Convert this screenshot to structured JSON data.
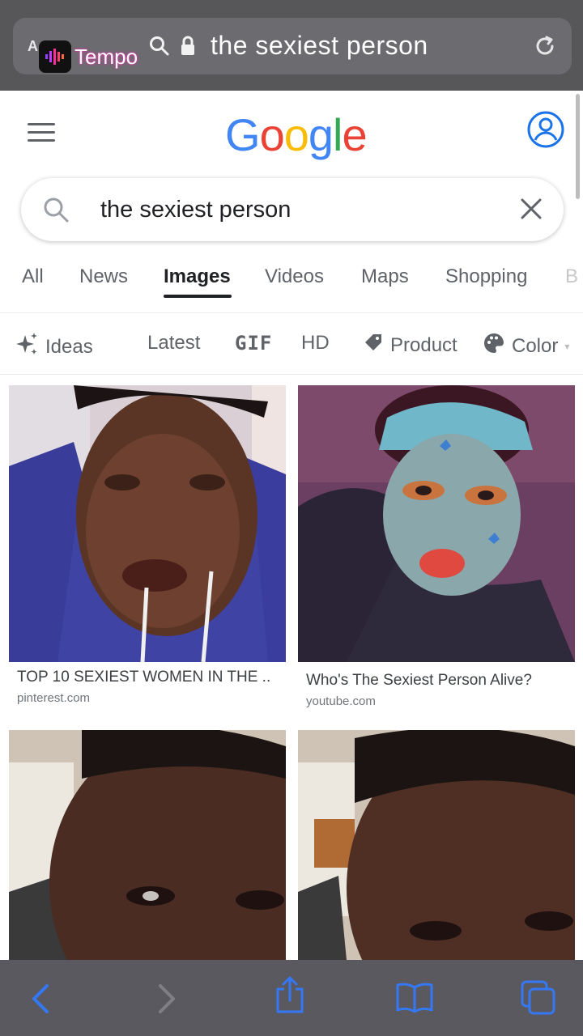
{
  "browser": {
    "aa_label": "A",
    "overlay_app": "Tempo",
    "url_text": "the sexiest person"
  },
  "google": {
    "logo_letters": [
      {
        "ch": "G",
        "color": "#4285F4"
      },
      {
        "ch": "o",
        "color": "#EA4335"
      },
      {
        "ch": "o",
        "color": "#FBBC05"
      },
      {
        "ch": "g",
        "color": "#4285F4"
      },
      {
        "ch": "l",
        "color": "#34A853"
      },
      {
        "ch": "e",
        "color": "#EA4335"
      }
    ],
    "query": "the sexiest person"
  },
  "tabs": [
    "All",
    "News",
    "Images",
    "Videos",
    "Maps",
    "Shopping",
    "B"
  ],
  "active_tab": "Images",
  "chips": {
    "ideas": "Ideas",
    "latest": "Latest",
    "gif": "GIF",
    "hd": "HD",
    "product": "Product",
    "color": "Color"
  },
  "results": [
    {
      "title": "TOP 10 SEXIEST WOMEN IN THE ..",
      "source": "pinterest.com"
    },
    {
      "title": "Who's The Sexiest Person Alive?",
      "source": "youtube.com"
    },
    {
      "title": "",
      "source": ""
    },
    {
      "title": "",
      "source": ""
    }
  ],
  "icons": {
    "menu": "hamburger-icon",
    "account": "account-circle-icon",
    "search": "search-icon",
    "clear": "close-icon",
    "back": "chevron-left-icon",
    "forward": "chevron-right-icon",
    "share": "share-icon",
    "bookmarks": "book-icon",
    "tabs": "tabs-icon"
  },
  "colors": {
    "accent": "#1a73e8",
    "safari_blue": "#3478f6"
  }
}
